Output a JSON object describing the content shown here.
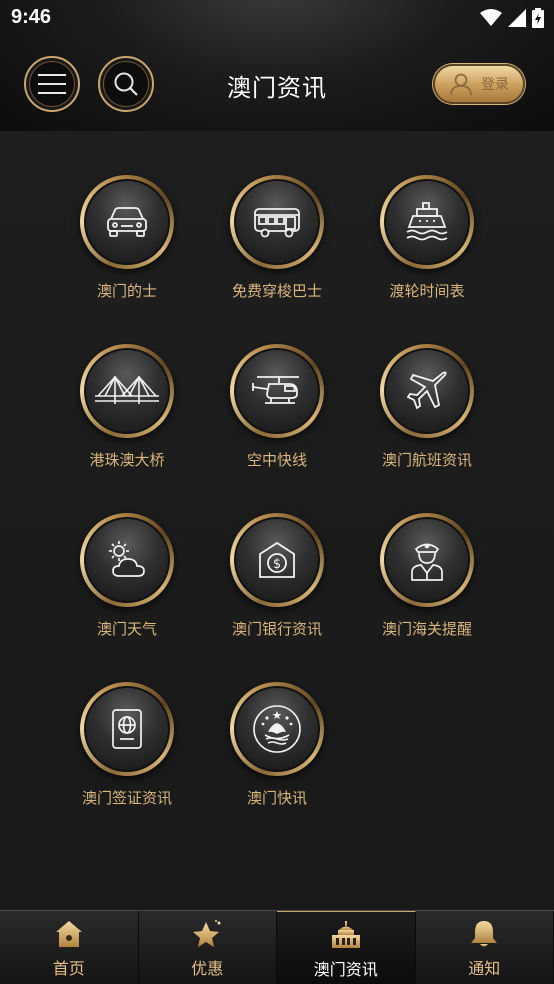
{
  "status_bar": {
    "time": "9:46"
  },
  "header": {
    "title": "澳门资讯",
    "login_label": "登录"
  },
  "grid": [
    {
      "label": "澳门的士",
      "icon": "taxi-icon"
    },
    {
      "label": "免费穿梭巴士",
      "icon": "bus-icon"
    },
    {
      "label": "渡轮时间表",
      "icon": "ferry-icon"
    },
    {
      "label": "港珠澳大桥",
      "icon": "bridge-icon"
    },
    {
      "label": "空中快线",
      "icon": "helicopter-icon"
    },
    {
      "label": "澳门航班资讯",
      "icon": "airplane-icon"
    },
    {
      "label": "澳门天气",
      "icon": "weather-icon"
    },
    {
      "label": "澳门银行资讯",
      "icon": "bank-icon"
    },
    {
      "label": "澳门海关提醒",
      "icon": "customs-officer-icon"
    },
    {
      "label": "澳门签证资讯",
      "icon": "passport-icon"
    },
    {
      "label": "澳门快讯",
      "icon": "macau-emblem-icon"
    }
  ],
  "tabbar": [
    {
      "label": "首页",
      "icon": "home-icon"
    },
    {
      "label": "优惠",
      "icon": "star-icon"
    },
    {
      "label": "澳门资讯",
      "icon": "building-icon",
      "active": true
    },
    {
      "label": "通知",
      "icon": "bell-icon"
    }
  ],
  "colors": {
    "gold": "#d9b77d",
    "background": "#1a1a1a"
  }
}
